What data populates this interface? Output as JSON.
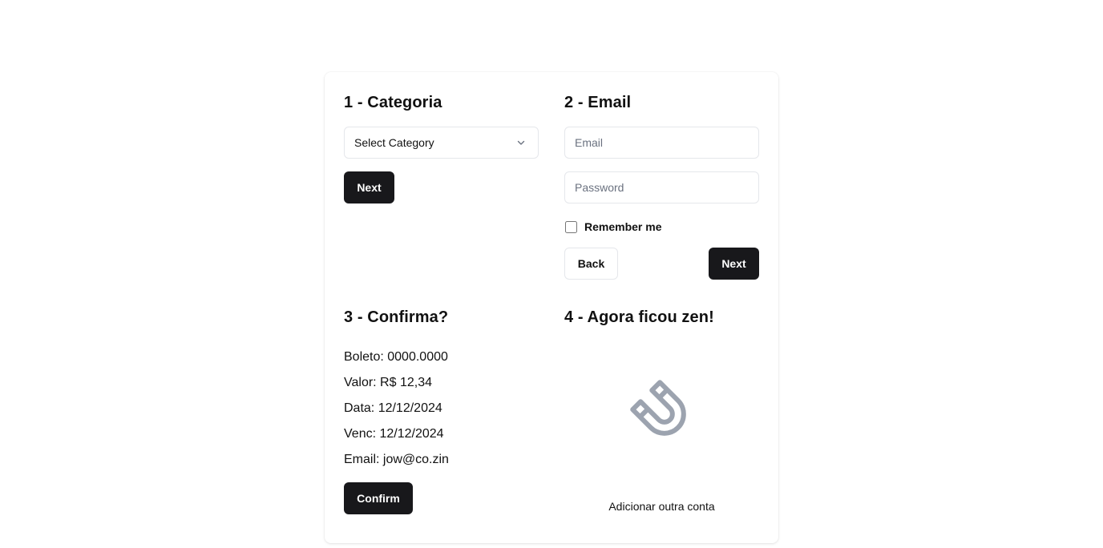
{
  "step1": {
    "title": "1 - Categoria",
    "select_value": "Select Category",
    "next_label": "Next"
  },
  "step2": {
    "title": "2 - Email",
    "email_placeholder": "Email",
    "password_placeholder": "Password",
    "remember_label": "Remember me",
    "back_label": "Back",
    "next_label": "Next"
  },
  "step3": {
    "title": "3 - Confirma?",
    "lines": [
      "Boleto: 0000.0000",
      "Valor: R$ 12,34",
      "Data: 12/12/2024",
      "Venc: 12/12/2024",
      "Email: jow@co.zin"
    ],
    "confirm_label": "Confirm"
  },
  "step4": {
    "title": "4 - Agora ficou zen!",
    "icon": "magnet-icon",
    "add_account_label": "Adicionar outra conta"
  },
  "colors": {
    "primary_button": "#18181b",
    "border": "#e5e7eb",
    "icon_gray": "#9ca3af"
  }
}
